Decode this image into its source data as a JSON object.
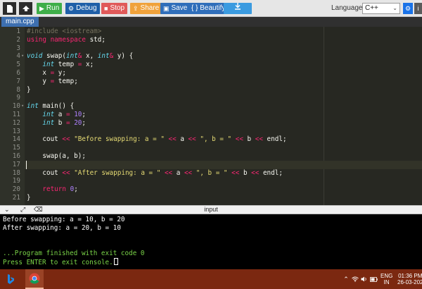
{
  "toolbar": {
    "run": "Run",
    "debug": "Debug",
    "stop": "Stop",
    "share": "Share",
    "save": "Save",
    "beautify": "{ } Beautify",
    "language_label": "Language",
    "language_value": "C++",
    "colors": {
      "run": "#3fae49",
      "debug": "#1f5fa8",
      "stop": "#e05a5a",
      "share": "#f0a23b",
      "save": "#2f6eba",
      "beautify": "#2f6eba",
      "download": "#3b9be0"
    }
  },
  "file_tab": "main.cpp",
  "editor": {
    "theme": "monokai",
    "active_line": 17,
    "lines": [
      [
        {
          "t": "#include <iostream>",
          "c": "cm"
        }
      ],
      [
        {
          "t": "using namespace ",
          "c": "kw"
        },
        {
          "t": "std;",
          "c": ""
        }
      ],
      [],
      [
        {
          "t": "void ",
          "c": "ty"
        },
        {
          "t": "swap(",
          "c": ""
        },
        {
          "t": "int",
          "c": "ty"
        },
        {
          "t": "& ",
          "c": "kw"
        },
        {
          "t": "x, ",
          "c": ""
        },
        {
          "t": "int",
          "c": "ty"
        },
        {
          "t": "& ",
          "c": "kw"
        },
        {
          "t": "y) {",
          "c": ""
        }
      ],
      [
        {
          "t": "    ",
          "c": ""
        },
        {
          "t": "int",
          "c": "ty"
        },
        {
          "t": " temp ",
          "c": ""
        },
        {
          "t": "=",
          "c": "kw"
        },
        {
          "t": " x;",
          "c": ""
        }
      ],
      [
        {
          "t": "    x ",
          "c": ""
        },
        {
          "t": "=",
          "c": "kw"
        },
        {
          "t": " y;",
          "c": ""
        }
      ],
      [
        {
          "t": "    y ",
          "c": ""
        },
        {
          "t": "=",
          "c": "kw"
        },
        {
          "t": " temp;",
          "c": ""
        }
      ],
      [
        {
          "t": "}",
          "c": ""
        }
      ],
      [],
      [
        {
          "t": "int",
          "c": "ty"
        },
        {
          "t": " main() {",
          "c": ""
        }
      ],
      [
        {
          "t": "    ",
          "c": ""
        },
        {
          "t": "int",
          "c": "ty"
        },
        {
          "t": " a ",
          "c": ""
        },
        {
          "t": "=",
          "c": "kw"
        },
        {
          "t": " ",
          "c": ""
        },
        {
          "t": "10",
          "c": "nu"
        },
        {
          "t": ";",
          "c": ""
        }
      ],
      [
        {
          "t": "    ",
          "c": ""
        },
        {
          "t": "int",
          "c": "ty"
        },
        {
          "t": " b ",
          "c": ""
        },
        {
          "t": "=",
          "c": "kw"
        },
        {
          "t": " ",
          "c": ""
        },
        {
          "t": "20",
          "c": "nu"
        },
        {
          "t": ";",
          "c": ""
        }
      ],
      [],
      [
        {
          "t": "    cout ",
          "c": ""
        },
        {
          "t": "<<",
          "c": "kw"
        },
        {
          "t": " ",
          "c": ""
        },
        {
          "t": "\"Before swapping: a = \"",
          "c": "st"
        },
        {
          "t": " ",
          "c": ""
        },
        {
          "t": "<<",
          "c": "kw"
        },
        {
          "t": " a ",
          "c": ""
        },
        {
          "t": "<<",
          "c": "kw"
        },
        {
          "t": " ",
          "c": ""
        },
        {
          "t": "\", b = \"",
          "c": "st"
        },
        {
          "t": " ",
          "c": ""
        },
        {
          "t": "<<",
          "c": "kw"
        },
        {
          "t": " b ",
          "c": ""
        },
        {
          "t": "<<",
          "c": "kw"
        },
        {
          "t": " endl;",
          "c": ""
        }
      ],
      [],
      [
        {
          "t": "    swap(a, b);",
          "c": ""
        }
      ],
      [],
      [
        {
          "t": "    cout ",
          "c": ""
        },
        {
          "t": "<<",
          "c": "kw"
        },
        {
          "t": " ",
          "c": ""
        },
        {
          "t": "\"After swapping: a = \"",
          "c": "st"
        },
        {
          "t": " ",
          "c": ""
        },
        {
          "t": "<<",
          "c": "kw"
        },
        {
          "t": " a ",
          "c": ""
        },
        {
          "t": "<<",
          "c": "kw"
        },
        {
          "t": " ",
          "c": ""
        },
        {
          "t": "\", b = \"",
          "c": "st"
        },
        {
          "t": " ",
          "c": ""
        },
        {
          "t": "<<",
          "c": "kw"
        },
        {
          "t": " b ",
          "c": ""
        },
        {
          "t": "<<",
          "c": "kw"
        },
        {
          "t": " endl;",
          "c": ""
        }
      ],
      [],
      [
        {
          "t": "    ",
          "c": ""
        },
        {
          "t": "return",
          "c": "kw"
        },
        {
          "t": " ",
          "c": ""
        },
        {
          "t": "0",
          "c": "nu"
        },
        {
          "t": ";",
          "c": ""
        }
      ],
      [
        {
          "t": "}",
          "c": ""
        }
      ]
    ],
    "fold_lines": [
      4,
      10
    ]
  },
  "console": {
    "header_label": "input",
    "output": [
      {
        "text": "Before swapping: a = 10, b = 20",
        "color": "white"
      },
      {
        "text": "After swapping: a = 20, b = 10",
        "color": "white"
      },
      {
        "text": "",
        "color": "white"
      },
      {
        "text": "",
        "color": "white"
      },
      {
        "text": "...Program finished with exit code 0",
        "color": "green"
      },
      {
        "text": "Press ENTER to exit console.",
        "color": "green"
      }
    ]
  },
  "taskbar": {
    "language": "ENG",
    "region": "IN",
    "time": "01:36 PM",
    "date": "26-03-202"
  }
}
